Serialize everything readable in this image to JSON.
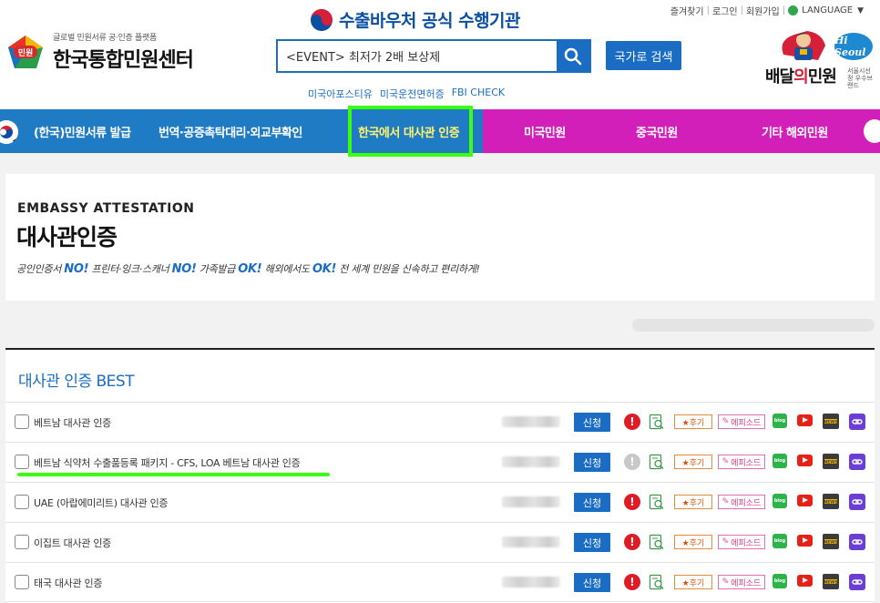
{
  "top_links": {
    "favorites": "즐겨찾기",
    "login": "로그인",
    "signup": "회원가입",
    "language": "LANGUAGE"
  },
  "logo": {
    "badge": "민원",
    "subtitle": "글로벌 민원서류 공·인증 플랫폼",
    "title": "한국통합민원센터"
  },
  "gov_banner": "수출바우처 공식 수행기관",
  "search": {
    "value": "<EVENT> 최저가 2배 보상제",
    "nation_button": "국가로 검색"
  },
  "quick_links": [
    "미국아포스티유",
    "미국운전면허증",
    "FBI CHECK"
  ],
  "delivery": {
    "hiseoul": "Hi Seoul",
    "brand_left": "배달",
    "brand_mid": "의",
    "brand_right": "민원",
    "sub": "서울시선정 우수브랜드"
  },
  "nav": {
    "items": [
      "(한국)민원서류 발급",
      "번역·공증촉탁대리·외교부확인",
      "한국에서 대사관 인증",
      "미국민원",
      "중국민원",
      "기타 해외민원"
    ],
    "active": "한국에서 대사관 인증",
    "colors": {
      "left": "#1f7bc4",
      "right": "#d21fba",
      "highlight": "#3aff0f"
    }
  },
  "hero": {
    "eyebrow": "EMBASSY ATTESTATION",
    "title": "대사관인증",
    "desc_1": "공인인증서 ",
    "no_1": "NO!",
    "desc_2": " 프린터·잉크·스캐너 ",
    "no_2": "NO!",
    "desc_3": " 가족발급 ",
    "ok_1": "OK!",
    "desc_4": " 해외에서도 ",
    "ok_2": "OK!",
    "desc_5": " 전 세계 민원을 신속하고 편리하게!"
  },
  "best": {
    "title": "대사관 인증 BEST",
    "apply_label": "신청",
    "review_label": "★후기",
    "episode_label": "에피소드",
    "blog_label": "blog",
    "news_label": "NEWS",
    "rows": [
      {
        "label": "베트남 대사관 인증",
        "warn": true
      },
      {
        "label": "베트남 식약처 수출품등록 패키지 - CFS, LOA 베트남 대사관 인증",
        "warn": false
      },
      {
        "label": "UAE (아랍에미리트) 대사관 인증",
        "warn": true
      },
      {
        "label": "이집트 대사관 인증",
        "warn": true
      },
      {
        "label": "태국 대사관 인증",
        "warn": true
      }
    ]
  }
}
